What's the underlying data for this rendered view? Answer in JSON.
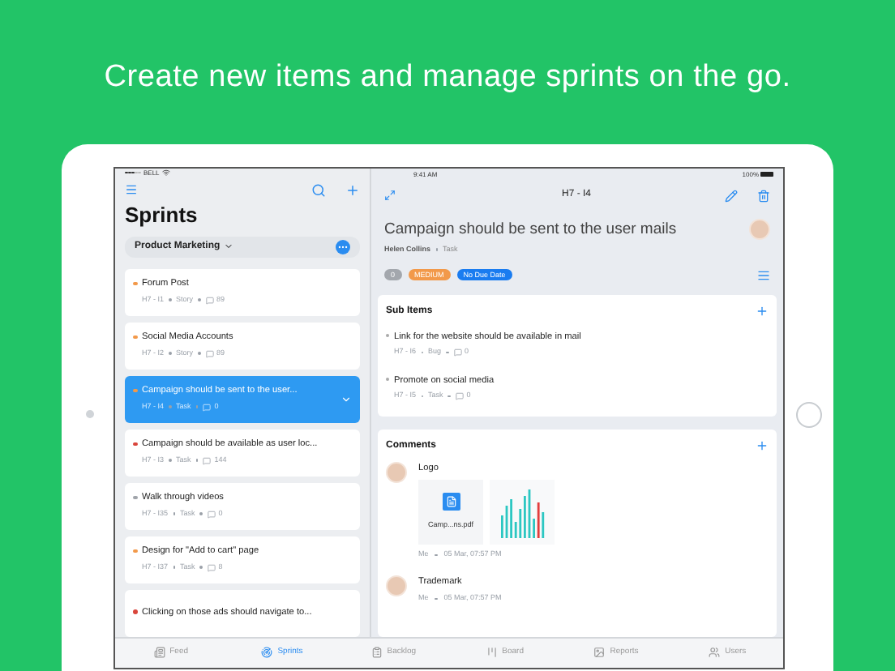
{
  "headline": "Create new items and manage sprints on the go.",
  "status_bar": {
    "carrier": "BELL",
    "time": "9:41 AM",
    "battery": "100%"
  },
  "sidebar": {
    "title": "Sprints",
    "project": "Product Marketing",
    "items": [
      {
        "title": "Forum Post",
        "id": "H7 - I1",
        "type": "Story",
        "count": "89",
        "color": "#f2994a",
        "selected": false
      },
      {
        "title": "Social Media Accounts",
        "id": "H7 - I2",
        "type": "Story",
        "count": "89",
        "color": "#f2994a",
        "selected": false
      },
      {
        "title": "Campaign should be sent to the user...",
        "id": "H7 - I4",
        "type": "Task",
        "count": "0",
        "color": "#f2994a",
        "selected": true
      },
      {
        "title": "Campaign should be available as user loc...",
        "id": "H7 - I3",
        "type": "Task",
        "count": "144",
        "color": "#d9453b",
        "selected": false
      },
      {
        "title": "Walk through videos",
        "id": "H7 - I35",
        "type": "Task",
        "count": "0",
        "color": "#a0a4aa",
        "selected": false
      },
      {
        "title": "Design for \"Add to cart\" page",
        "id": "H7 - I37",
        "type": "Task",
        "count": "8",
        "color": "#f2994a",
        "selected": false
      },
      {
        "title": "Clicking on those ads should navigate to...",
        "color": "#d9453b",
        "selected": false
      }
    ]
  },
  "detail": {
    "header": "H7 - I4",
    "title": "Campaign should be sent to the user mails",
    "author": "Helen Collins",
    "type": "Task",
    "tags": [
      {
        "text": "0",
        "color": "#a3a7ad"
      },
      {
        "text": "MEDIUM",
        "color": "#f2994a"
      },
      {
        "text": "No Due Date",
        "color": "#1a7cf0"
      }
    ],
    "sub_items": {
      "title": "Sub Items",
      "items": [
        {
          "title": "Link for the website should be available in mail",
          "id": "H7 - I6",
          "type": "Bug",
          "count": "0"
        },
        {
          "title": "Promote on social media",
          "id": "H7 - I5",
          "type": "Task",
          "count": "0"
        }
      ]
    },
    "comments": {
      "title": "Comments",
      "items": [
        {
          "text": "Logo",
          "attachments": [
            {
              "kind": "file",
              "name": "Camp...ns.pdf"
            },
            {
              "kind": "chart"
            }
          ],
          "author": "Me",
          "time": "05 Mar, 07:57 PM"
        },
        {
          "text": "Trademark",
          "author": "Me",
          "time": "05 Mar, 07:57 PM"
        }
      ]
    }
  },
  "tabs": [
    {
      "label": "Feed",
      "selected": false
    },
    {
      "label": "Sprints",
      "selected": true
    },
    {
      "label": "Backlog",
      "selected": false
    },
    {
      "label": "Board",
      "selected": false
    },
    {
      "label": "Reports",
      "selected": false
    },
    {
      "label": "Users",
      "selected": false
    }
  ]
}
